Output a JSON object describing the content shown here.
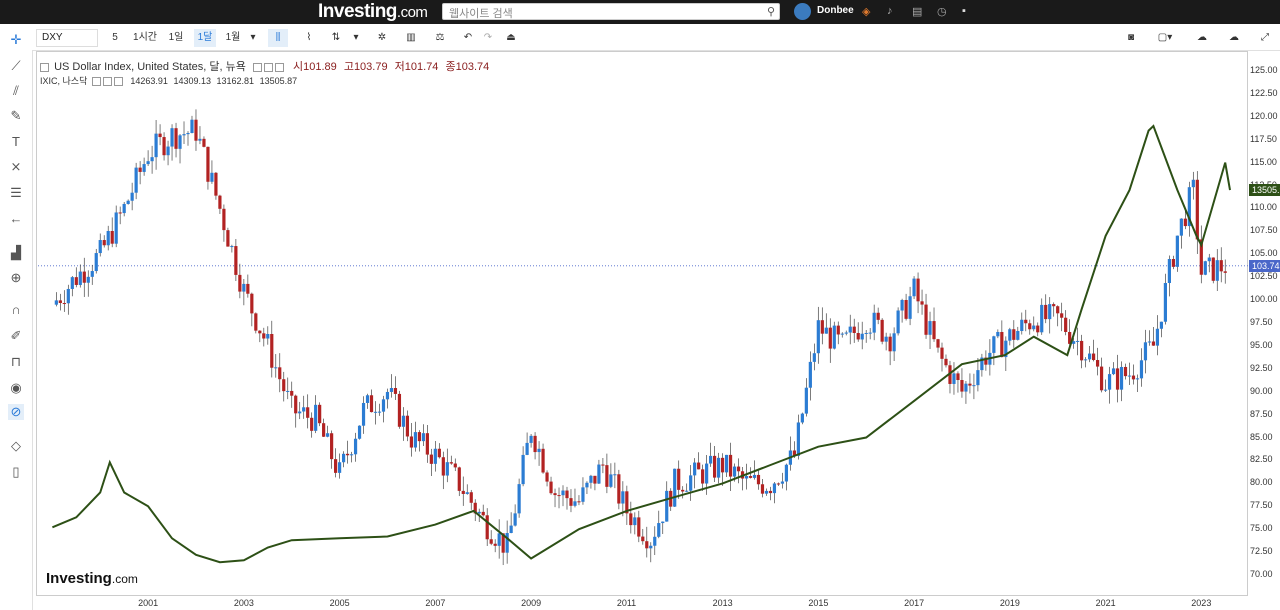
{
  "header": {
    "logo_main": "Investing",
    "logo_domain": ".com",
    "search_placeholder": "웹사이트 검색",
    "username": "Donbee"
  },
  "toolbar": {
    "symbol": "DXY",
    "intervals": [
      "5",
      "1시간",
      "1일",
      "1달",
      "1월"
    ],
    "active_interval": "1달"
  },
  "legend": {
    "main_title": "US Dollar Index, United States, 달, 뉴욕",
    "open_label": "시",
    "open": "101.89",
    "high_label": "고",
    "high": "103.79",
    "low_label": "저",
    "low": "101.74",
    "close_label": "종",
    "close": "103.74",
    "compare_title": "IXIC, 나스닥",
    "compare_values": [
      "14263.91",
      "14309.13",
      "13162.81",
      "13505.87"
    ]
  },
  "watermark": {
    "main": "Investing",
    "domain": ".com"
  },
  "colors": {
    "up": "#2b7cd3",
    "down": "#b22222",
    "compare_line": "#2d5016",
    "price_line": "#4a67c9"
  },
  "price_tag": "103.74",
  "compare_tag": "13505.9",
  "chart_data": {
    "type": "line",
    "title": "US Dollar Index, United States, 달, 뉴욕",
    "xlabel": "",
    "ylabel": "",
    "ylim": [
      69,
      126.5
    ],
    "y_ticks": [
      70.0,
      72.5,
      75.0,
      77.5,
      80.0,
      82.5,
      85.0,
      87.5,
      90.0,
      92.5,
      95.0,
      97.5,
      100.0,
      102.5,
      105.0,
      107.5,
      110.0,
      112.5,
      115.0,
      117.5,
      120.0,
      122.5,
      125.0
    ],
    "y_tick_labels": [
      "70.00",
      "72.50",
      "75.00",
      "77.50",
      "80.00",
      "82.50",
      "85.00",
      "87.50",
      "90.00",
      "92.50",
      "95.00",
      "97.50",
      "100.00",
      "102.50",
      "105.00",
      "107.50",
      "110.00",
      "112.50",
      "115.00",
      "117.50",
      "120.00",
      "122.50",
      "125.00"
    ],
    "x_ticks": [
      "2001",
      "2003",
      "2005",
      "2007",
      "2009",
      "2011",
      "2013",
      "2015",
      "2017",
      "2019",
      "2021",
      "2023"
    ],
    "current_price": 103.74,
    "series": [
      {
        "name": "US Dollar Index",
        "style": "monthly_candles",
        "x": [
          1999.0,
          1999.5,
          2000.0,
          2000.5,
          2001.0,
          2001.5,
          2002.0,
          2002.5,
          2003.0,
          2003.5,
          2004.0,
          2004.5,
          2005.0,
          2005.5,
          2006.0,
          2006.5,
          2007.0,
          2007.5,
          2008.0,
          2008.5,
          2009.0,
          2009.5,
          2010.0,
          2010.5,
          2011.0,
          2011.5,
          2012.0,
          2012.5,
          2013.0,
          2013.5,
          2014.0,
          2014.5,
          2015.0,
          2015.5,
          2016.0,
          2016.5,
          2017.0,
          2017.5,
          2018.0,
          2018.5,
          2019.0,
          2019.5,
          2020.0,
          2020.5,
          2021.0,
          2021.5,
          2022.0,
          2022.5,
          2022.83,
          2023.0,
          2023.5
        ],
        "y": [
          99.5,
          102.5,
          105,
          110,
          116,
          118,
          118.5,
          110,
          101,
          95,
          88,
          87,
          81,
          88,
          90,
          85,
          83,
          80,
          76,
          73,
          86,
          79,
          78,
          82,
          77,
          74,
          80,
          81,
          82,
          80,
          80,
          83,
          97,
          95,
          98,
          96,
          101,
          94,
          90,
          94,
          96,
          98,
          98,
          95,
          91,
          92,
          95,
          107,
          112,
          103,
          103.74
        ]
      },
      {
        "name": "IXIC",
        "style": "line",
        "x": [
          1999.0,
          1999.5,
          2000.0,
          2000.2,
          2000.5,
          2001.0,
          2001.5,
          2002.0,
          2002.5,
          2003.0,
          2003.5,
          2004.0,
          2005.0,
          2006.0,
          2007.0,
          2007.8,
          2008.5,
          2009.0,
          2010.0,
          2011.0,
          2012.0,
          2013.0,
          2014.0,
          2015.0,
          2016.0,
          2017.0,
          2018.0,
          2018.9,
          2019.5,
          2020.2,
          2020.5,
          2021.0,
          2021.5,
          2021.9,
          2022.0,
          2022.5,
          2022.9,
          2023.0,
          2023.5,
          2023.6
        ],
        "y": [
          75.2,
          76.3,
          79,
          82.3,
          79,
          77.5,
          74,
          72.2,
          71.4,
          71.6,
          73,
          73.8,
          74,
          74.2,
          75.5,
          77,
          74,
          71.8,
          75,
          77,
          78.5,
          80,
          82,
          84,
          85,
          89,
          93,
          94,
          96,
          94,
          99,
          107,
          112,
          118.5,
          119,
          112,
          107,
          106,
          115,
          112
        ]
      }
    ]
  }
}
